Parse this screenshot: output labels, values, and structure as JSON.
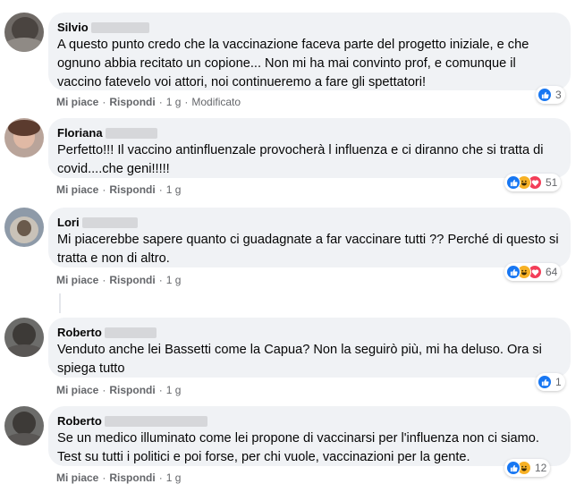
{
  "colors": {
    "bubble": "#f0f2f5",
    "meta_text": "#65676b",
    "like_blue": "#1877f2",
    "haha_yellow": "#f7b125",
    "love_red": "#f33e58"
  },
  "actions": {
    "like_label": "Mi piace",
    "reply_label": "Rispondi",
    "separator": "·"
  },
  "comments": [
    {
      "author": "Silvio",
      "text": "A questo punto credo che la vaccinazione faceva parte del progetto iniziale, e che ognuno abbia recitato un copione... Non mi ha mai convinto prof, e comunque il vaccino fatevelo voi attori, noi continueremo a fare gli spettatori!",
      "time": "1 g",
      "edited": "Modificato",
      "reactions": [
        "like-icon"
      ],
      "reaction_count": "3"
    },
    {
      "author": "Floriana",
      "text": "Perfetto!!! Il vaccino antinfluenzale provocherà l influenza e ci diranno che si tratta di covid....che geni!!!!!",
      "time": "1 g",
      "reactions": [
        "like-icon",
        "haha-icon",
        "love-icon"
      ],
      "reaction_count": "51"
    },
    {
      "author": "Lori",
      "text": "Mi piacerebbe sapere quanto ci guadagnate a far vaccinare tutti ?? Perché di questo si tratta e non di altro.",
      "time": "1 g",
      "reactions": [
        "like-icon",
        "haha-icon",
        "love-icon"
      ],
      "reaction_count": "64"
    },
    {
      "author": "Roberto",
      "text": "Venduto anche lei Bassetti come la Capua? Non la seguirò più, mi ha deluso. Ora si spiega tutto",
      "time": "1 g",
      "reactions": [
        "like-icon"
      ],
      "reaction_count": "1"
    },
    {
      "author": "Roberto",
      "text": "Se un medico illuminato come lei propone di vaccinarsi per l'influenza non ci siamo. Test su tutti i politici e poi forse, per chi vuole, vaccinazioni per la gente.",
      "time": "1 g",
      "reactions": [
        "like-icon",
        "haha-icon"
      ],
      "reaction_count": "12"
    }
  ]
}
